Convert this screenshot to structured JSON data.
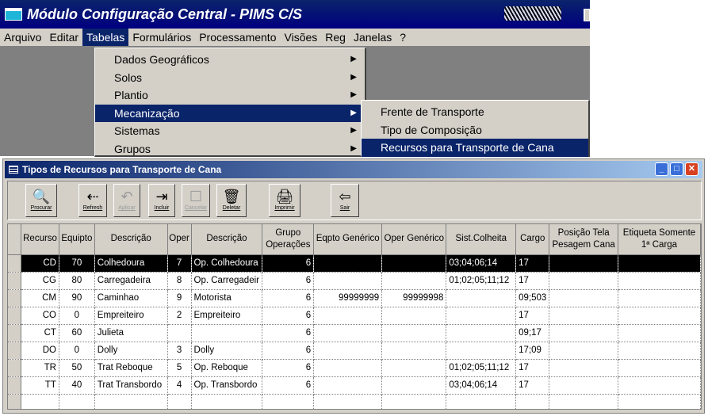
{
  "window": {
    "title": "Módulo Configuração Central - PIMS C/S"
  },
  "menubar": [
    "Arquivo",
    "Editar",
    "Tabelas",
    "Formulários",
    "Processamento",
    "Visões",
    "Reg",
    "Janelas",
    "?"
  ],
  "tabelas_menu": [
    "Dados Geográficos",
    "Solos",
    "Plantio",
    "Mecanização",
    "Sistemas",
    "Grupos"
  ],
  "mecanizacao_menu": [
    "Frente de Transporte",
    "Tipo de Composição",
    "Recursos para Transporte de Cana"
  ],
  "child": {
    "title": "Tipos de Recursos para Transporte de Cana",
    "toolbar": [
      {
        "label": "Procurar",
        "icon": "search-icon"
      },
      {
        "label": "Refresh",
        "icon": "refresh-icon"
      },
      {
        "label": "Aplicar",
        "icon": "apply-icon"
      },
      {
        "label": "Incluir",
        "icon": "add-icon"
      },
      {
        "label": "Cancelar",
        "icon": "cancel-icon"
      },
      {
        "label": "Deletar",
        "icon": "delete-icon"
      },
      {
        "label": "Imprimir",
        "icon": "print-icon"
      },
      {
        "label": "Sair",
        "icon": "exit-icon"
      }
    ]
  },
  "grid": {
    "headers": [
      "Recurso",
      "Equipto",
      "Descrição",
      "Oper",
      "Descrição",
      "Grupo Operações",
      "Eqpto Genérico",
      "Oper Genérico",
      "Sist.Colheita",
      "Cargo",
      "Posição Tela Pesagem Cana",
      "Etiqueta Somente 1ª Carga"
    ],
    "rows": [
      [
        "CD",
        "70",
        "Colhedoura",
        "7",
        "Op. Colhedoura",
        "6",
        "",
        "",
        "03;04;06;14",
        "17",
        "",
        ""
      ],
      [
        "CG",
        "80",
        "Carregadeira",
        "8",
        "Op. Carregadeir",
        "6",
        "",
        "",
        "01;02;05;11;12",
        "17",
        "",
        ""
      ],
      [
        "CM",
        "90",
        "Caminhao",
        "9",
        "Motorista",
        "6",
        "99999999",
        "99999998",
        "",
        "09;503",
        "",
        ""
      ],
      [
        "CO",
        "0",
        "Empreiteiro",
        "2",
        "Empreiteiro",
        "6",
        "",
        "",
        "",
        "17",
        "",
        ""
      ],
      [
        "CT",
        "60",
        "Julieta",
        "",
        "",
        "6",
        "",
        "",
        "",
        "09;17",
        "",
        ""
      ],
      [
        "DO",
        "0",
        "Dolly",
        "3",
        "Dolly",
        "6",
        "",
        "",
        "",
        "17;09",
        "",
        ""
      ],
      [
        "TR",
        "50",
        "Trat Reboque",
        "5",
        "Op. Reboque",
        "6",
        "",
        "",
        "01;02;05;11;12",
        "17",
        "",
        ""
      ],
      [
        "TT",
        "40",
        "Trat Transbordo",
        "4",
        "Op. Transbordo",
        "6",
        "",
        "",
        "03;04;06;14",
        "17",
        "",
        ""
      ]
    ]
  }
}
